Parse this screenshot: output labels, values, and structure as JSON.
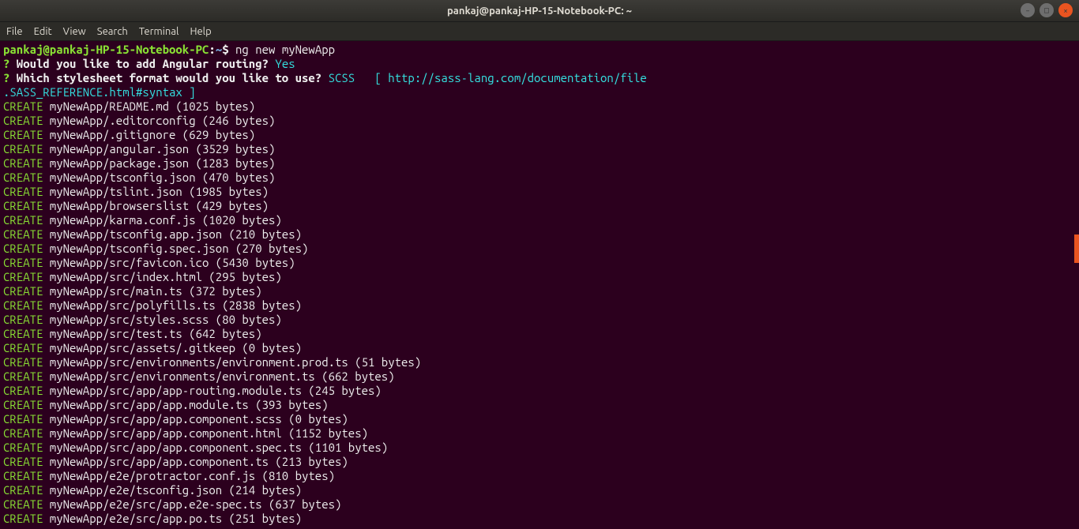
{
  "titlebar": {
    "title": "pankaj@pankaj-HP-15-Notebook-PC: ~"
  },
  "menubar": {
    "items": [
      "File",
      "Edit",
      "View",
      "Search",
      "Terminal",
      "Help"
    ]
  },
  "prompt": {
    "user_host": "pankaj@pankaj-HP-15-Notebook-PC",
    "colon": ":",
    "path": "~",
    "dollar": "$ ",
    "command": "ng new myNewApp"
  },
  "q1": {
    "mark": "?",
    "text": " Would you like to add Angular routing? ",
    "answer": "Yes"
  },
  "q2": {
    "mark": "?",
    "text": " Which stylesheet format would you like to use? ",
    "answer": "SCSS   ",
    "hint": "[ http://sass-lang.com/documentation/file"
  },
  "q2b": {
    "text": ".SASS_REFERENCE.html#syntax ]"
  },
  "createLabel": "CREATE",
  "files": [
    " myNewApp/README.md (1025 bytes)",
    " myNewApp/.editorconfig (246 bytes)",
    " myNewApp/.gitignore (629 bytes)",
    " myNewApp/angular.json (3529 bytes)",
    " myNewApp/package.json (1283 bytes)",
    " myNewApp/tsconfig.json (470 bytes)",
    " myNewApp/tslint.json (1985 bytes)",
    " myNewApp/browserslist (429 bytes)",
    " myNewApp/karma.conf.js (1020 bytes)",
    " myNewApp/tsconfig.app.json (210 bytes)",
    " myNewApp/tsconfig.spec.json (270 bytes)",
    " myNewApp/src/favicon.ico (5430 bytes)",
    " myNewApp/src/index.html (295 bytes)",
    " myNewApp/src/main.ts (372 bytes)",
    " myNewApp/src/polyfills.ts (2838 bytes)",
    " myNewApp/src/styles.scss (80 bytes)",
    " myNewApp/src/test.ts (642 bytes)",
    " myNewApp/src/assets/.gitkeep (0 bytes)",
    " myNewApp/src/environments/environment.prod.ts (51 bytes)",
    " myNewApp/src/environments/environment.ts (662 bytes)",
    " myNewApp/src/app/app-routing.module.ts (245 bytes)",
    " myNewApp/src/app/app.module.ts (393 bytes)",
    " myNewApp/src/app/app.component.scss (0 bytes)",
    " myNewApp/src/app/app.component.html (1152 bytes)",
    " myNewApp/src/app/app.component.spec.ts (1101 bytes)",
    " myNewApp/src/app/app.component.ts (213 bytes)",
    " myNewApp/e2e/protractor.conf.js (810 bytes)",
    " myNewApp/e2e/tsconfig.json (214 bytes)",
    " myNewApp/e2e/src/app.e2e-spec.ts (637 bytes)",
    " myNewApp/e2e/src/app.po.ts (251 bytes)"
  ]
}
